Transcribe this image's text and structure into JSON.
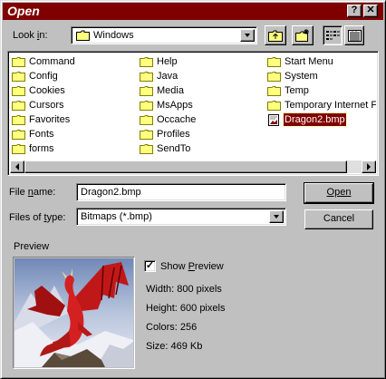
{
  "window": {
    "title": "Open",
    "close_glyph": "?",
    "help_glyph": "✕"
  },
  "look_in": {
    "label": "Look in:",
    "value": "Windows",
    "icon": "folder-icon"
  },
  "toolbar": {
    "up_folder_icon": "up-folder-icon",
    "new_folder_icon": "new-folder-icon",
    "list_view_icon": "list-view-icon",
    "details_view_icon": "details-view-icon"
  },
  "files": {
    "columns": [
      [
        "Command",
        "Config",
        "Cookies",
        "Cursors",
        "Favorites",
        "Fonts",
        "forms"
      ],
      [
        "Help",
        "Java",
        "Media",
        "MsApps",
        "Occache",
        "Profiles",
        "SendTo"
      ],
      [
        "Start Menu",
        "System",
        "Temp",
        "Temporary Internet Files",
        "Dragon2.bmp"
      ]
    ],
    "selected": "Dragon2.bmp"
  },
  "file_name": {
    "label": "File name:",
    "value": "Dragon2.bmp"
  },
  "file_type": {
    "label": "Files of type:",
    "value": "Bitmaps (*.bmp)"
  },
  "buttons": {
    "open": "Open",
    "cancel": "Cancel"
  },
  "preview": {
    "label": "Preview",
    "show_preview_label": "Show Preview",
    "show_preview_checked": true,
    "width": "Width: 800 pixels",
    "height": "Height: 600 pixels",
    "colors": "Colors: 256",
    "size": "Size: 469 Kb"
  },
  "colors": {
    "titlebar": "#800000",
    "face": "#c0c0c0",
    "folder": "#ffff80",
    "selection": "#800000"
  }
}
